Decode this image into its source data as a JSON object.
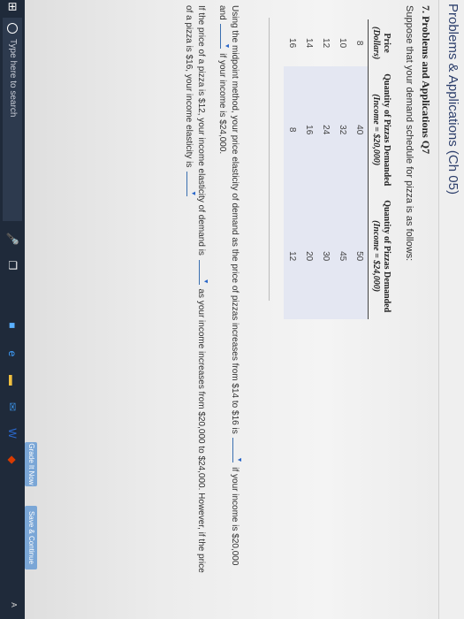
{
  "header": {
    "title": "Problems & Applications (Ch 05)"
  },
  "question": {
    "title": "7. Problems and Applications Q7",
    "intro": "Suppose that your demand schedule for pizza is as follows:"
  },
  "table": {
    "headers": [
      {
        "main": "Price",
        "sub": "(Dollars)"
      },
      {
        "main": "Quantity of Pizzas Demanded",
        "sub": "(Income = $20,000)"
      },
      {
        "main": "Quantity of Pizzas Demanded",
        "sub": "(Income = $24,000)"
      }
    ],
    "rows": [
      [
        "8",
        "40",
        "50"
      ],
      [
        "10",
        "32",
        "45"
      ],
      [
        "12",
        "24",
        "30"
      ],
      [
        "14",
        "16",
        "20"
      ],
      [
        "16",
        "8",
        "12"
      ]
    ]
  },
  "q1": {
    "part1": "Using the midpoint method, your price elasticity of demand as the price of pizzas increases from $14 to $16 is",
    "part2": "if your income is $20,000",
    "part3": "and",
    "part4": "if your income is $24,000."
  },
  "q2": {
    "part1": "If the price of a pizza is $12, your income elasticity of demand is",
    "part2": "as your income increases from $20,000 to $24,000. However, if the price",
    "part3": "of a pizza is $16, your income elasticity is"
  },
  "buttons": {
    "grade": "Grade It Now",
    "save": "Save & Continue"
  },
  "taskbar": {
    "search_placeholder": "Type here to search"
  }
}
